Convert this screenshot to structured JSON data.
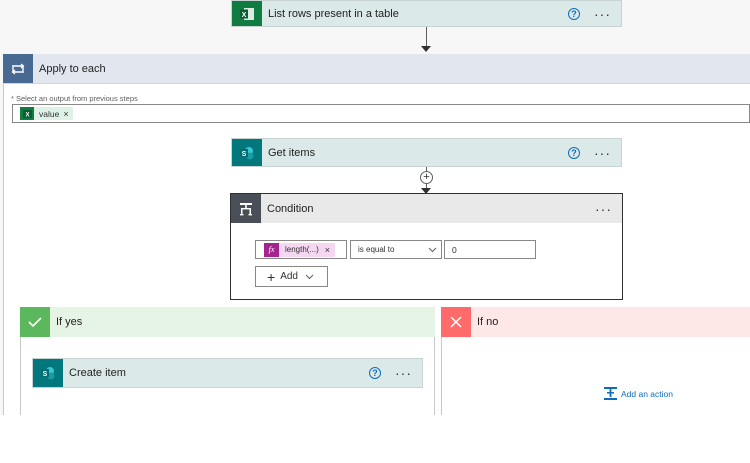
{
  "list_rows": {
    "title": "List rows present in a table",
    "help": "?",
    "more": "···",
    "icon": "excel-icon"
  },
  "apply_each": {
    "title": "Apply to each",
    "field_label": "* Select an output from previous steps",
    "token_label": "value",
    "token_remove": "×",
    "icon": "loop-icon"
  },
  "get_items": {
    "title": "Get items",
    "help": "?",
    "more": "···",
    "icon": "sharepoint-icon"
  },
  "insert": {
    "symbol": "+"
  },
  "condition": {
    "title": "Condition",
    "more": "···",
    "icon": "condition-icon",
    "left_token": "length(...)",
    "left_token_icon": "fx",
    "token_remove": "×",
    "operator": "is equal to",
    "right_value": "0",
    "add_label": "Add"
  },
  "if_yes": {
    "title": "If yes",
    "icon": "check-icon"
  },
  "if_no": {
    "title": "If no",
    "icon": "close-icon",
    "add_action": "Add an action"
  },
  "create_item": {
    "title": "Create item",
    "help": "?",
    "more": "···",
    "icon": "sharepoint-icon"
  },
  "colors": {
    "excel": "#107c41",
    "loop_header": "#e1e6ef",
    "loop_icon": "#486991",
    "sharepoint": "#03787c",
    "card_header": "#dce9e9",
    "condition_icon": "#484f58",
    "yes": "#5cb85c",
    "no": "#ff6b6b",
    "link": "#0f6cbd"
  }
}
